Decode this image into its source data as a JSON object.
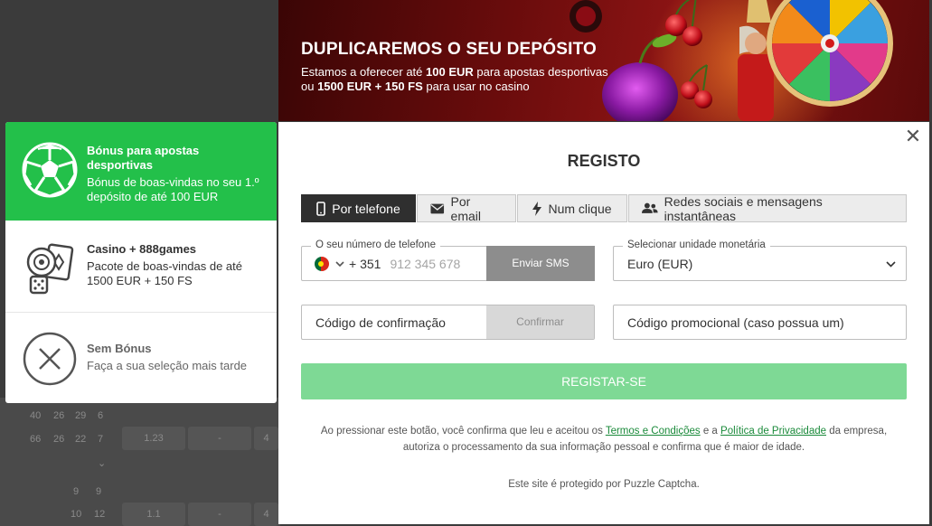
{
  "banner": {
    "title": "DUPLICAREMOS O SEU DEPÓSITO",
    "line1_pre": "Estamos a oferecer até ",
    "line1_bold": "100 EUR",
    "line1_post": " para apostas desportivas",
    "line2_pre": "ou ",
    "line2_bold": "1500 EUR + 150 FS",
    "line2_post": " para usar no casino"
  },
  "bonuses": [
    {
      "title": "Bónus para apostas desportivas",
      "desc": "Bónus de boas-vindas no seu 1.º depósito de até 100 EUR",
      "icon": "soccer-ball-icon",
      "active": true
    },
    {
      "title": "Casino + 888games",
      "desc": "Pacote de boas-vindas de até 1500 EUR + 150 FS",
      "icon": "casino-cards-dice-icon",
      "active": false
    },
    {
      "title": "Sem Bónus",
      "desc": "Faça a sua seleção mais tarde",
      "icon": "no-bonus-x-icon",
      "active": false
    }
  ],
  "modal": {
    "title": "REGISTO",
    "close_icon": "close-icon",
    "tabs": [
      {
        "label": "Por telefone",
        "icon": "phone-icon",
        "active": true
      },
      {
        "label": "Por email",
        "icon": "envelope-icon",
        "active": false
      },
      {
        "label": "Num clique",
        "icon": "lightning-icon",
        "active": false
      },
      {
        "label": "Redes sociais e mensagens instantâneas",
        "icon": "users-icon",
        "active": false
      }
    ],
    "phone": {
      "legend": "O seu número de telefone",
      "prefix": "+ 351",
      "placeholder": "912 345 678",
      "send_sms": "Enviar SMS"
    },
    "currency": {
      "legend": "Selecionar unidade monetária",
      "value": "Euro (EUR)"
    },
    "confirmation": {
      "placeholder": "Código de confirmação",
      "confirm": "Confirmar"
    },
    "promo": {
      "placeholder": "Código promocional (caso possua um)"
    },
    "register": "REGISTAR-SE",
    "legal": {
      "pre": "Ao pressionar este botão, você confirma que leu e aceitou os ",
      "terms": "Termos e Condições",
      "mid": " e a ",
      "privacy": "Política de Privacidade",
      "post": " da empresa, autoriza o processamento da sua informação pessoal e confirma que é maior de idade."
    },
    "captcha": "Este site é protegido por Puzzle Captcha."
  },
  "background": {
    "rows": [
      [
        "40",
        "26",
        "29",
        "6"
      ],
      [
        "66",
        "26",
        "22",
        "7",
        "1.23",
        "-",
        "4"
      ],
      [
        "9",
        "9"
      ],
      [
        "10",
        "12",
        "1.1",
        "-",
        "4"
      ]
    ]
  },
  "colors": {
    "accent_green": "#23c04a",
    "register_green": "#7ed995",
    "dark_tab": "#2f2f2f",
    "link_green": "#1a8a3a"
  }
}
